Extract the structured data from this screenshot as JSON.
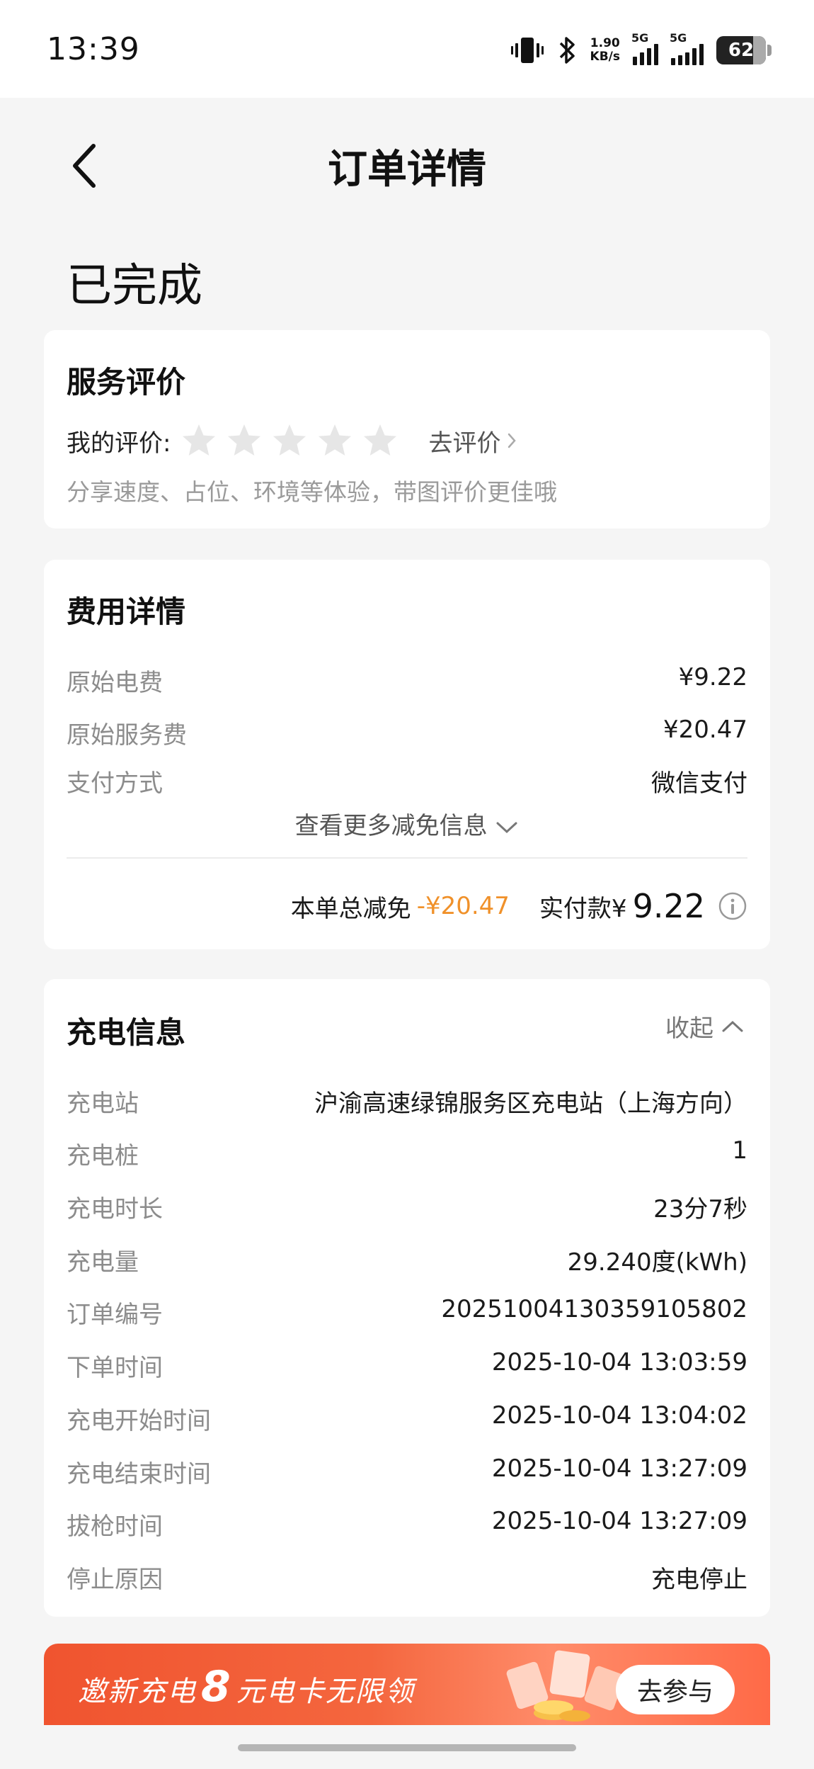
{
  "status_bar": {
    "time": "13:39",
    "net_speed_value": "1.90",
    "net_speed_unit": "KB/s",
    "signal1_label": "5G",
    "signal2_label": "5G",
    "battery": "62",
    "icons": [
      "vibrate-icon",
      "bluetooth-icon",
      "signal-icon",
      "battery-icon"
    ]
  },
  "header": {
    "title": "订单详情",
    "back_icon": "chevron-left-icon"
  },
  "order_status": "已完成",
  "rating": {
    "title": "服务评价",
    "my_rating_label": "我的评价:",
    "stars_total": 5,
    "stars_filled": 0,
    "rate_link": "去评价",
    "hint": "分享速度、占位、环境等体验，带图评价更佳哦"
  },
  "fees": {
    "title": "费用详情",
    "rows": [
      {
        "label": "原始电费",
        "value": "¥9.22"
      },
      {
        "label": "原始服务费",
        "value": "¥20.47"
      },
      {
        "label": "支付方式",
        "value": "微信支付"
      }
    ],
    "more_info": "查看更多减免信息",
    "total_discount_label": "本单总减免",
    "total_discount_value": "-¥20.47",
    "paid_label": "实付款¥",
    "paid_amount": "9.22"
  },
  "charging": {
    "title": "充电信息",
    "collapse_label": "收起",
    "rows": [
      {
        "label": "充电站",
        "value": "沪渝高速绿锦服务区充电站（上海方向）"
      },
      {
        "label": "充电桩",
        "value": "1"
      },
      {
        "label": "充电时长",
        "value": "23分7秒"
      },
      {
        "label": "充电量",
        "value": "29.240度(kWh)"
      },
      {
        "label": "订单编号",
        "value": "20251004130359105802"
      },
      {
        "label": "下单时间",
        "value": "2025-10-04 13:03:59"
      },
      {
        "label": "充电开始时间",
        "value": "2025-10-04 13:04:02"
      },
      {
        "label": "充电结束时间",
        "value": "2025-10-04 13:27:09"
      },
      {
        "label": "拔枪时间",
        "value": "2025-10-04 13:27:09"
      },
      {
        "label": "停止原因",
        "value": "充电停止"
      }
    ]
  },
  "banner": {
    "text_prefix": "邀新充电",
    "text_big": "8",
    "text_suffix": "元电卡无限领",
    "button": "去参与"
  },
  "colors": {
    "accent_orange": "#f0912a",
    "banner_red": "#f0542f",
    "star_gray": "#e6e6e6"
  }
}
